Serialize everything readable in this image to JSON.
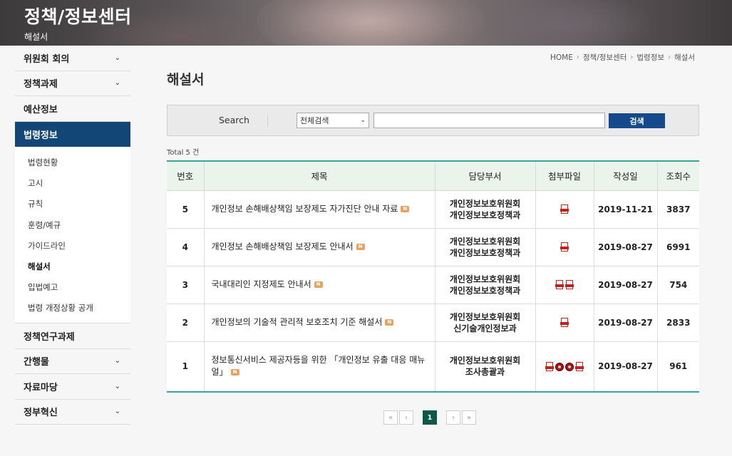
{
  "banner": {
    "title": "정책/정보센터",
    "subtitle": "해설서"
  },
  "sidebar": {
    "items": [
      {
        "label": "위원회 회의",
        "chevron": "⌄"
      },
      {
        "label": "정책과제",
        "chevron": "⌄"
      },
      {
        "label": "예산정보",
        "chevron": ""
      },
      {
        "label": "법령정보",
        "chevron": ""
      },
      {
        "label": "정책연구과제",
        "chevron": ""
      },
      {
        "label": "간행물",
        "chevron": "⌄"
      },
      {
        "label": "자료마당",
        "chevron": "⌄"
      },
      {
        "label": "정부혁신",
        "chevron": "⌄"
      }
    ],
    "sub_items": [
      "법령현황",
      "고시",
      "규칙",
      "훈령/예규",
      "가이드라인",
      "해설서",
      "입법예고",
      "법령 개정상황 공개"
    ]
  },
  "breadcrumb": {
    "items": [
      "HOME",
      "정책/정보센터",
      "법령정보",
      "해설서"
    ],
    "separator": "›"
  },
  "page": {
    "title": "해설서",
    "total_label": "Total 5 건"
  },
  "search": {
    "label": "Search",
    "select_value": "전체검색",
    "select_arrow": "⌄",
    "input_value": "",
    "button_label": "검색"
  },
  "table": {
    "headers": [
      "번호",
      "제목",
      "담당부서",
      "첨부파일",
      "작성일",
      "조회수"
    ],
    "rows": [
      {
        "num": "5",
        "title": "개인정보 손해배상책임 보장제도 자가진단 안내 자료",
        "dept1": "개인정보보호위원회",
        "dept2": "개인정보보호정책과",
        "files": [
          "pdf"
        ],
        "date": "2019-11-21",
        "views": "3837"
      },
      {
        "num": "4",
        "title": "개인정보 손해배상책임 보장제도 안내서",
        "dept1": "개인정보보호위원회",
        "dept2": "개인정보보호정책과",
        "files": [
          "pdf"
        ],
        "date": "2019-08-27",
        "views": "6991"
      },
      {
        "num": "3",
        "title": "국내대리인 지정제도 안내서",
        "dept1": "개인정보보호위원회",
        "dept2": "개인정보보호정책과",
        "files": [
          "pdf",
          "pdf"
        ],
        "date": "2019-08-27",
        "views": "754"
      },
      {
        "num": "2",
        "title": "개인정보의 기술적 관리적 보호조치 기준 해설서",
        "dept1": "개인정보보호위원회",
        "dept2": "신기술개인정보과",
        "files": [
          "pdf"
        ],
        "date": "2019-08-27",
        "views": "2833"
      },
      {
        "num": "1",
        "title": "정보통신서비스 제공자등을 위한 「개인정보 유출 대응 매뉴얼」",
        "dept1": "개인정보보호위원회",
        "dept2": "조사총괄과",
        "files": [
          "pdf",
          "other",
          "other",
          "pdf"
        ],
        "date": "2019-08-27",
        "views": "961"
      }
    ],
    "new_badge": "N"
  },
  "pagination": {
    "first": "«",
    "prev": "‹",
    "current": "1",
    "next": "›",
    "last": "»"
  },
  "colors": {
    "accent": "#124677",
    "table_border": "#3aa596",
    "header_bg": "#eaf4ea",
    "page_current": "#0e5a4a"
  }
}
